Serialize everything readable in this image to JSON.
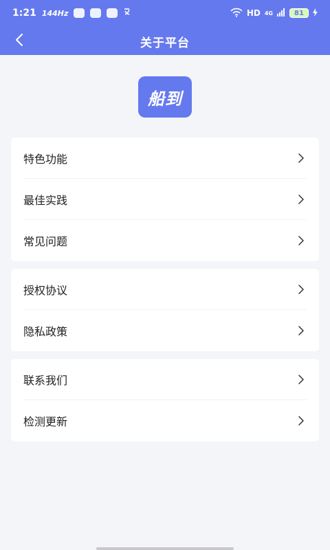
{
  "status_bar": {
    "time": "1:21",
    "refresh_rate": "144Hz",
    "network": "HD",
    "signal": "4G",
    "battery": "81"
  },
  "header": {
    "title": "关于平台"
  },
  "logo": {
    "text": "船到"
  },
  "groups": [
    {
      "items": [
        {
          "label": "特色功能"
        },
        {
          "label": "最佳实践"
        },
        {
          "label": "常见问题"
        }
      ]
    },
    {
      "items": [
        {
          "label": "授权协议"
        },
        {
          "label": "隐私政策"
        }
      ]
    },
    {
      "items": [
        {
          "label": "联系我们"
        },
        {
          "label": "检测更新"
        }
      ]
    }
  ],
  "colors": {
    "primary": "#6579ee",
    "background": "#f4f5f8"
  }
}
